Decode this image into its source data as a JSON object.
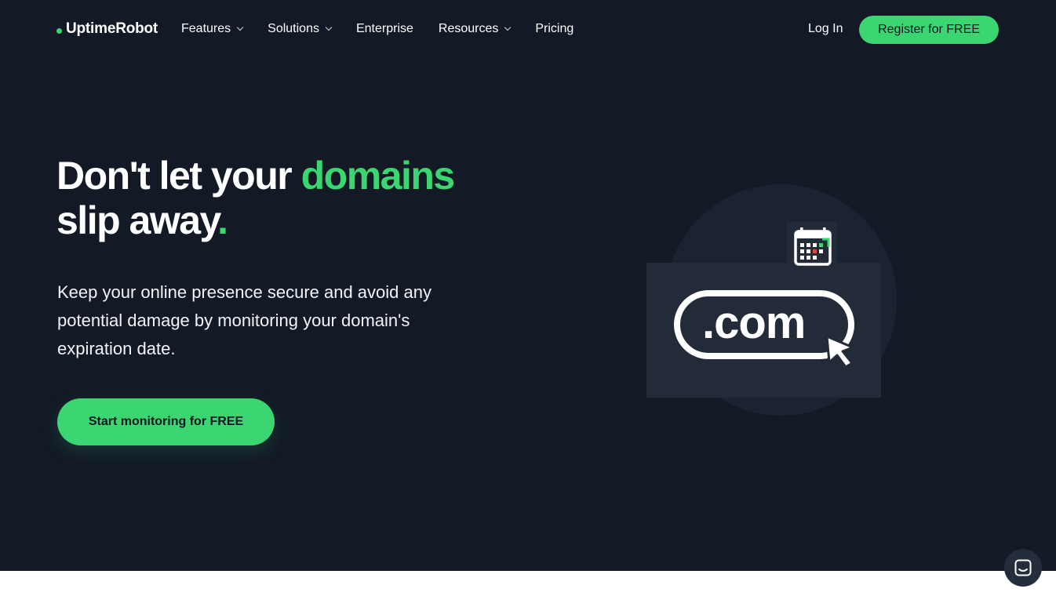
{
  "brand": {
    "name": "UptimeRobot",
    "accent": "#3bd671",
    "background": "#131a26"
  },
  "nav": {
    "items": [
      {
        "label": "Features",
        "dropdown": true
      },
      {
        "label": "Solutions",
        "dropdown": true
      },
      {
        "label": "Enterprise",
        "dropdown": false
      },
      {
        "label": "Resources",
        "dropdown": true
      },
      {
        "label": "Pricing",
        "dropdown": false
      }
    ],
    "login": "Log In",
    "register": "Register for FREE"
  },
  "hero": {
    "title_part1": "Don't let your ",
    "title_highlight": "domains",
    "title_part2": "slip away",
    "title_period": ".",
    "subtitle": "Keep your online presence secure and avoid any potential damage by monitoring your domain's expiration date.",
    "cta": "Start monitoring for FREE",
    "illustration": {
      "domain_text": ".com",
      "icons": [
        "calendar-icon",
        "cursor-icon"
      ]
    }
  },
  "chat": {
    "icon": "chat-icon"
  }
}
